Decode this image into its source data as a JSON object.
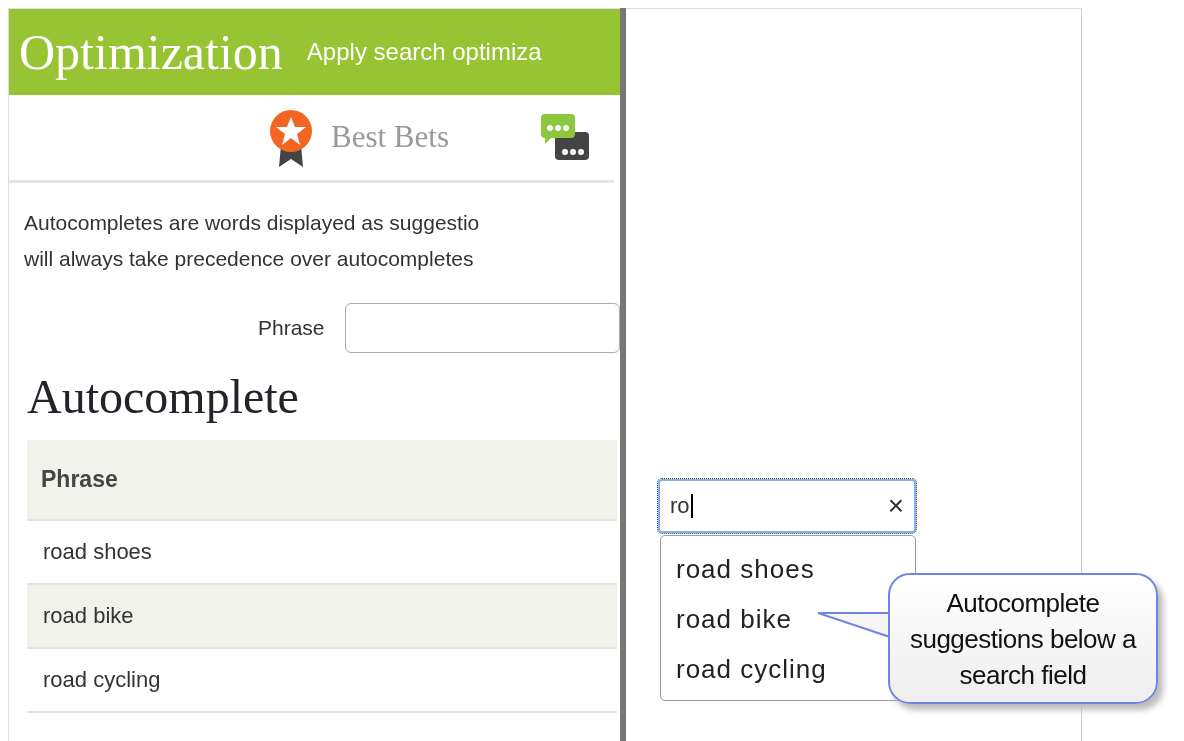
{
  "header": {
    "title": "Optimization",
    "subtitle": "Apply search optimiza"
  },
  "tabs": [
    {
      "kind": "best-bets",
      "label": "Best Bets"
    },
    {
      "kind": "chat"
    }
  ],
  "intro_lines": [
    "Autocompletes are words displayed as suggestio",
    "will always take precedence over autocompletes"
  ],
  "form": {
    "label": "Phrase"
  },
  "section_title": "Autocomplete",
  "table": {
    "columns": [
      "Phrase"
    ],
    "rows": [
      [
        "road shoes"
      ],
      [
        "road bike"
      ],
      [
        "road cycling"
      ]
    ]
  },
  "search": {
    "value": "ro",
    "clear": "×",
    "suggestions": [
      "road shoes",
      "road bike",
      "road cycling"
    ]
  },
  "callout": "Autocomplete suggestions below a search field"
}
